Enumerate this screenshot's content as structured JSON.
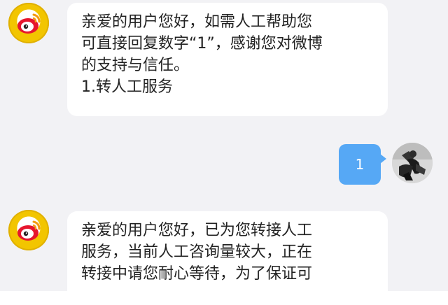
{
  "messages": [
    {
      "sender": "official",
      "icon": "weibo-official-avatar-icon",
      "lines": [
        "亲爱的用户您好，如需人工帮助您",
        "可直接回复数字“1”，感谢您对微博",
        "的支持与信任。",
        "1.转人工服务"
      ]
    },
    {
      "sender": "user",
      "icon": "user-avatar-icon",
      "text": "1"
    },
    {
      "sender": "official",
      "icon": "weibo-official-avatar-icon",
      "lines": [
        "亲爱的用户您好，已为您转接人工",
        "服务，当前人工咨询量较大，正在",
        "转接中请您耐心等待，为了保证可"
      ]
    }
  ],
  "colors": {
    "background": "#f2f2f5",
    "bubble_incoming": "#ffffff",
    "bubble_outgoing": "#56a8f5",
    "avatar_ring": "#f2c500"
  }
}
